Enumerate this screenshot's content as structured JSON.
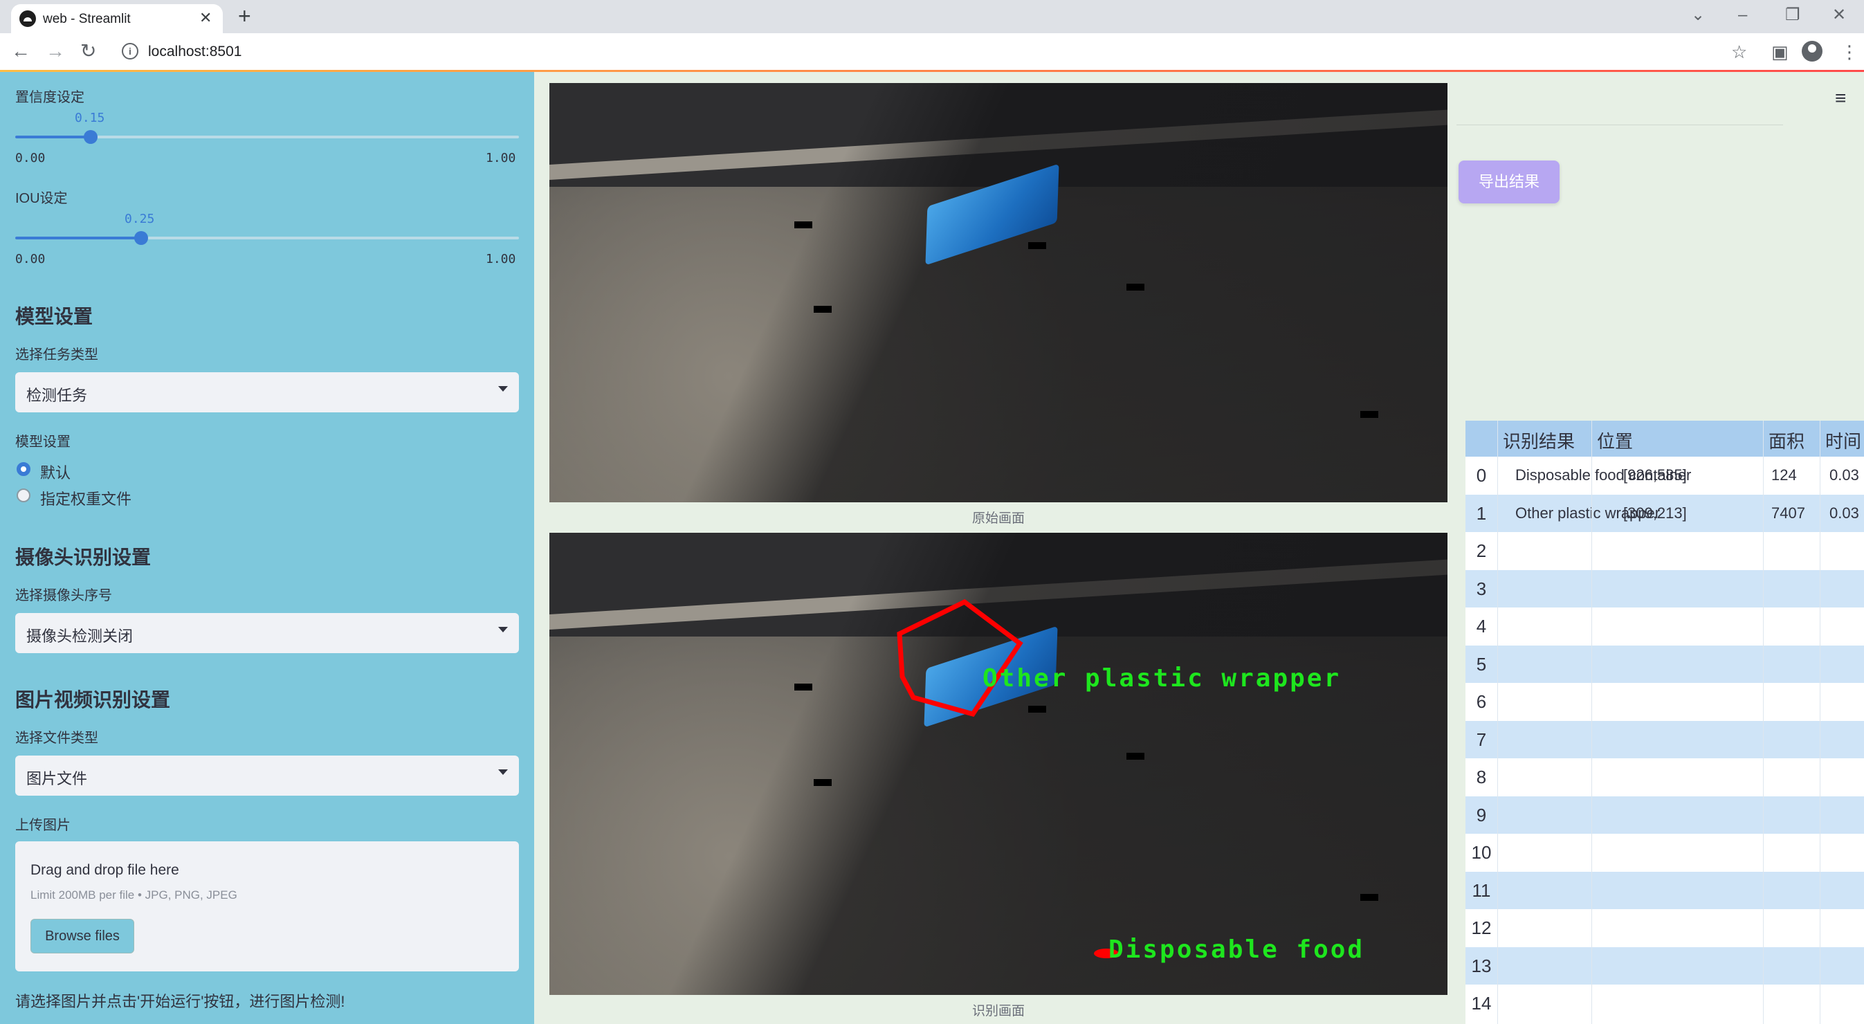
{
  "browser": {
    "tab_title": "web - Streamlit",
    "url": "localhost:8501"
  },
  "sidebar": {
    "confidence": {
      "label": "置信度设定",
      "value": "0.15",
      "fraction": 0.15,
      "min": "0.00",
      "max": "1.00"
    },
    "iou": {
      "label": "IOU设定",
      "value": "0.25",
      "fraction": 0.25,
      "min": "0.00",
      "max": "1.00"
    },
    "model_header": "模型设置",
    "task_type_label": "选择任务类型",
    "task_type_value": "检测任务",
    "model_setting_label": "模型设置",
    "radio_options": [
      "默认",
      "指定权重文件"
    ],
    "radio_selected": 0,
    "camera_header": "摄像头识别设置",
    "camera_select_label": "选择摄像头序号",
    "camera_select_value": "摄像头检测关闭",
    "media_header": "图片视频识别设置",
    "file_type_label": "选择文件类型",
    "file_type_value": "图片文件",
    "upload_label": "上传图片",
    "upload_title": "Drag and drop file here",
    "upload_limit": "Limit 200MB per file • JPG, PNG, JPEG",
    "browse_button": "Browse files",
    "footnote": "请选择图片并点击'开始运行'按钮，进行图片检测!"
  },
  "main": {
    "original_caption": "原始画面",
    "result_caption": "识别画面",
    "export_button": "导出结果",
    "detections": [
      {
        "label": "Other plastic wrapper",
        "color": "#ff0000"
      },
      {
        "label": "Disposable food",
        "color": "#ff0000"
      }
    ]
  },
  "table": {
    "columns": [
      "识别结果",
      "位置",
      "面积",
      "时间"
    ],
    "rows": [
      {
        "index": "0",
        "result": "Disposable food container",
        "position": "[926,585]",
        "area": "124",
        "time": "0.03"
      },
      {
        "index": "1",
        "result": "Other plastic wrapper",
        "position": "[309,213]",
        "area": "7407",
        "time": "0.03"
      },
      {
        "index": "2"
      },
      {
        "index": "3"
      },
      {
        "index": "4"
      },
      {
        "index": "5"
      },
      {
        "index": "6"
      },
      {
        "index": "7"
      },
      {
        "index": "8"
      },
      {
        "index": "9"
      },
      {
        "index": "10"
      },
      {
        "index": "11"
      },
      {
        "index": "12"
      },
      {
        "index": "13"
      },
      {
        "index": "14"
      }
    ]
  },
  "colors": {
    "sidebar_bg": "#7ec8dc",
    "main_bg": "#e7f0e5",
    "accent": "#3a7bd5",
    "detection_text": "#1ee61e",
    "export_button": "#b7a7f2"
  }
}
